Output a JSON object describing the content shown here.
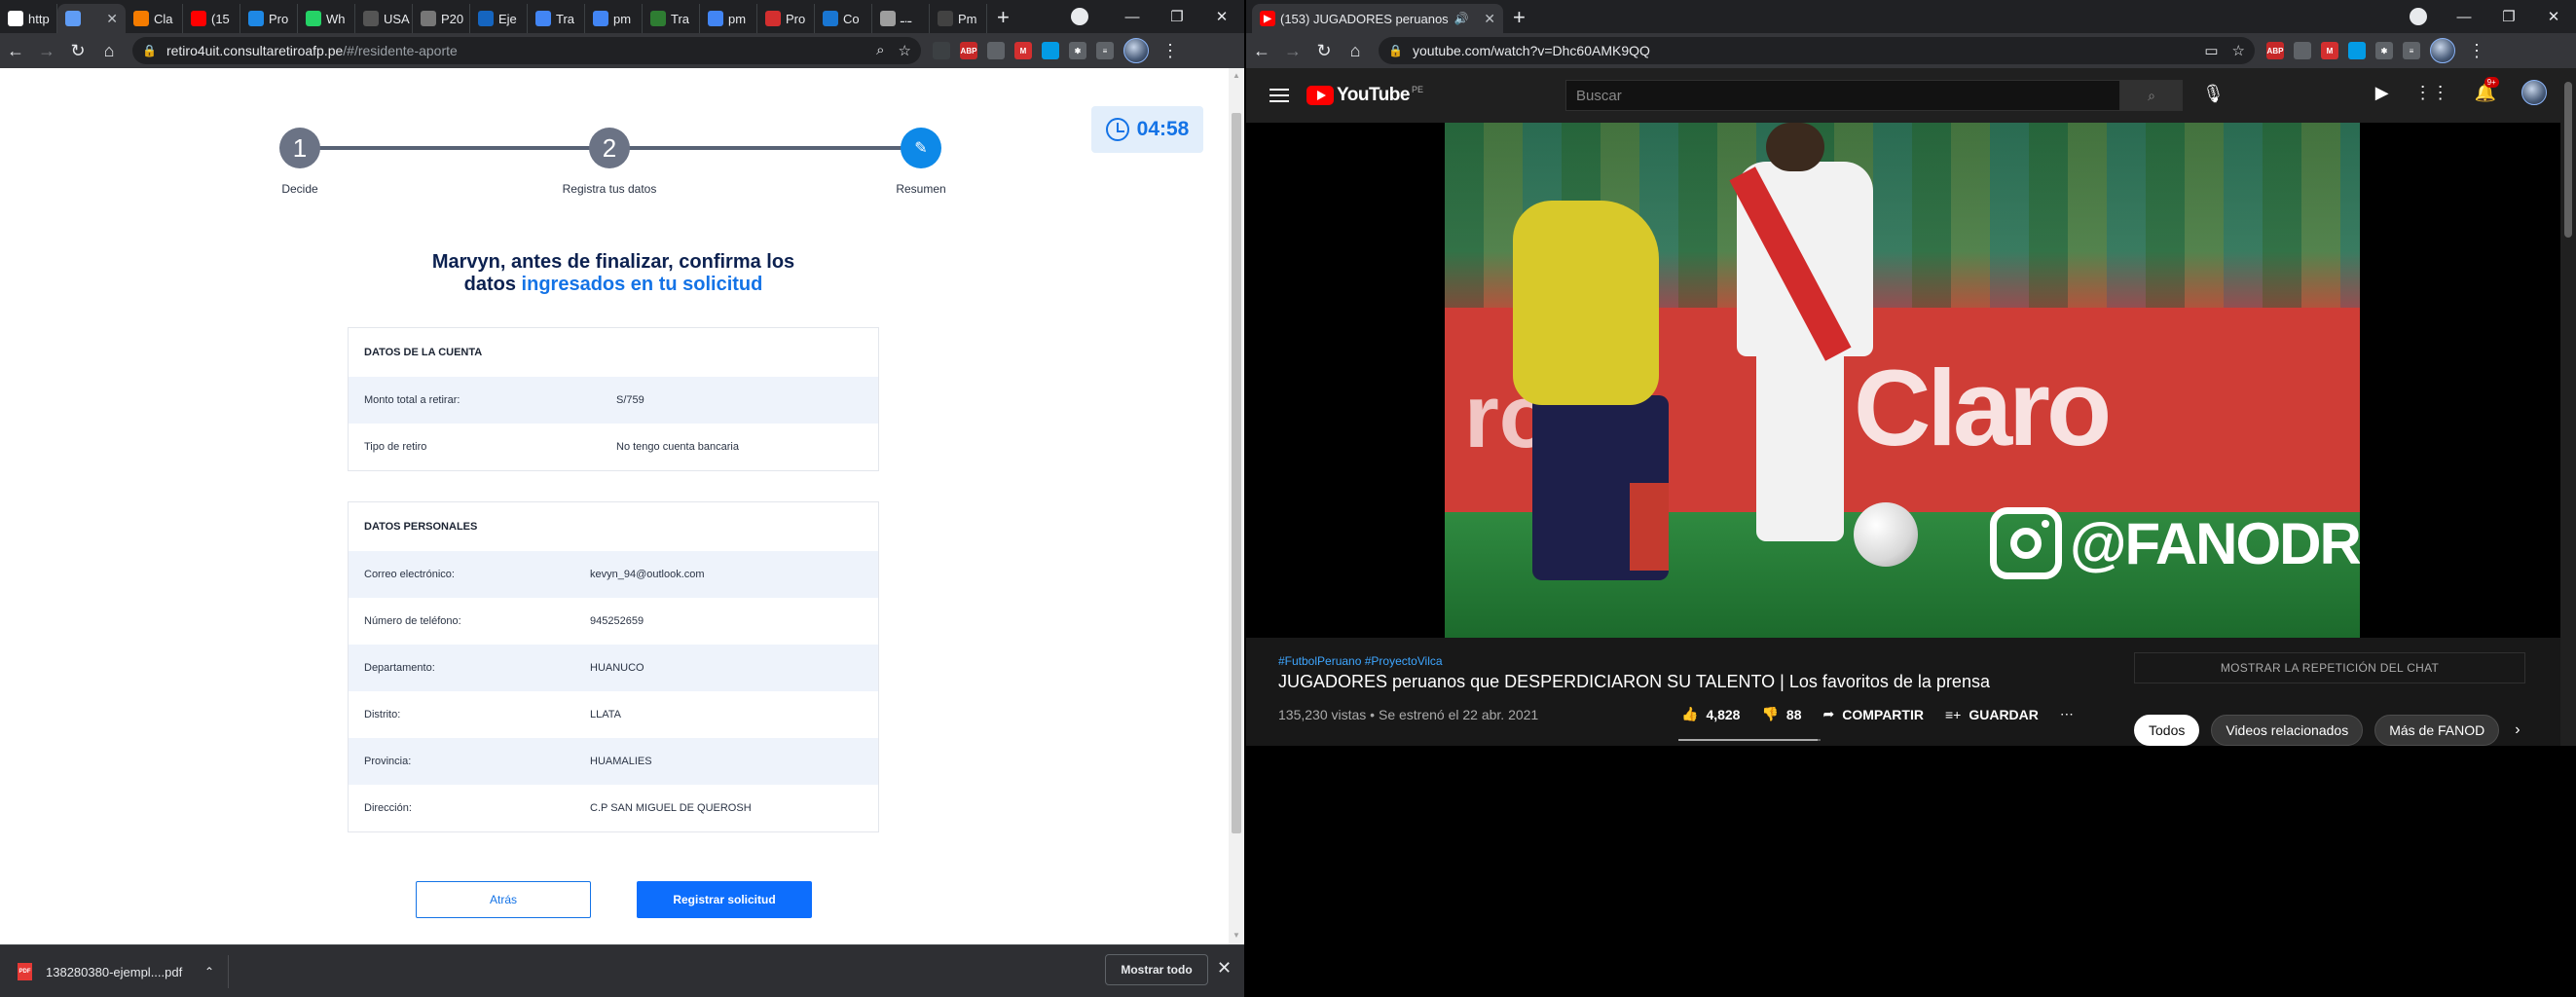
{
  "left_window": {
    "tabs": [
      {
        "label": "http",
        "color": "#ffffff",
        "active": false
      },
      {
        "label": "",
        "color": "#5f9cf5",
        "active": true
      },
      {
        "label": "Cla",
        "color": "#f57c00",
        "active": false
      },
      {
        "label": "(15",
        "color": "#ff0000",
        "active": false
      },
      {
        "label": "Pro",
        "color": "#1e88e5",
        "active": false
      },
      {
        "label": "Wh",
        "color": "#25d366",
        "active": false
      },
      {
        "label": "USA",
        "color": "#555555",
        "active": false
      },
      {
        "label": "P20",
        "color": "#777777",
        "active": false
      },
      {
        "label": "Eje",
        "color": "#1565c0",
        "active": false
      },
      {
        "label": "Tra",
        "color": "#4285f4",
        "active": false
      },
      {
        "label": "pm",
        "color": "#4285f4",
        "active": false
      },
      {
        "label": "Tra",
        "color": "#2e7d32",
        "active": false
      },
      {
        "label": "pm",
        "color": "#4285f4",
        "active": false
      },
      {
        "label": "Pro",
        "color": "#d32f2f",
        "active": false
      },
      {
        "label": "Co",
        "color": "#1976d2",
        "active": false
      },
      {
        "label": "ـ.ـ",
        "color": "#9e9e9e",
        "active": false
      },
      {
        "label": "Pm",
        "color": "#424242",
        "active": false
      }
    ],
    "url": {
      "host": "retiro4uit.consultaretiroafp.pe",
      "path": "/#/residente-aporte"
    },
    "steps": [
      {
        "num": "1",
        "label": "Decide"
      },
      {
        "num": "2",
        "label": "Registra tus datos"
      },
      {
        "num": "✎",
        "label": "Resumen"
      }
    ],
    "timer": "04:58",
    "heading": {
      "part1": "Marvyn, antes de finalizar, confirma los",
      "part2": "datos ",
      "part3": "ingresados en tu solicitud"
    },
    "account": {
      "title": "DATOS DE LA CUENTA",
      "rows": [
        {
          "label": "Monto total a retirar:",
          "value": "S/759"
        },
        {
          "label": "Tipo de retiro",
          "value": "No tengo cuenta bancaria"
        }
      ]
    },
    "personal": {
      "title": "DATOS PERSONALES",
      "rows": [
        {
          "label": "Correo electrónico:",
          "value": "kevyn_94@outlook.com"
        },
        {
          "label": "Número de teléfono:",
          "value": "945252659"
        },
        {
          "label": "Departamento:",
          "value": "HUANUCO"
        },
        {
          "label": "Distrito:",
          "value": "LLATA"
        },
        {
          "label": "Provincia:",
          "value": "HUAMALIES"
        },
        {
          "label": "Dirección:",
          "value": "C.P SAN MIGUEL DE QUEROSH"
        }
      ]
    },
    "buttons": {
      "back": "Atrás",
      "submit": "Registrar solicitud"
    },
    "download": {
      "file": "138280380-ejempl....pdf",
      "show_all": "Mostrar todo",
      "icon_text": "PDF"
    }
  },
  "right_window": {
    "tab_title": "(153) JUGADORES peruanos",
    "url": "youtube.com/watch?v=Dhc60AMK9QQ",
    "yt": {
      "logo": "YouTube",
      "region": "PE",
      "search_placeholder": "Buscar",
      "notif_count": "9+",
      "hashtags": "#FutbolPeruano #ProyectoVilca",
      "title": "JUGADORES peruanos que DESPERDICIARON SU TALENTO | Los favoritos de la prensa",
      "views": "135,230 vistas",
      "date": "Se estrenó el 22 abr. 2021",
      "likes": "4,828",
      "dislikes": "88",
      "share": "COMPARTIR",
      "save": "GUARDAR",
      "chat_replay": "MOSTRAR LA REPETICIÓN DEL CHAT",
      "chips": [
        "Todos",
        "Videos relacionados",
        "Más de FANOD"
      ],
      "like_ratio": 0.98,
      "video": {
        "sponsor": "Claro",
        "sponsor_left": "rot",
        "watermark": "@FANODRIC"
      }
    }
  }
}
